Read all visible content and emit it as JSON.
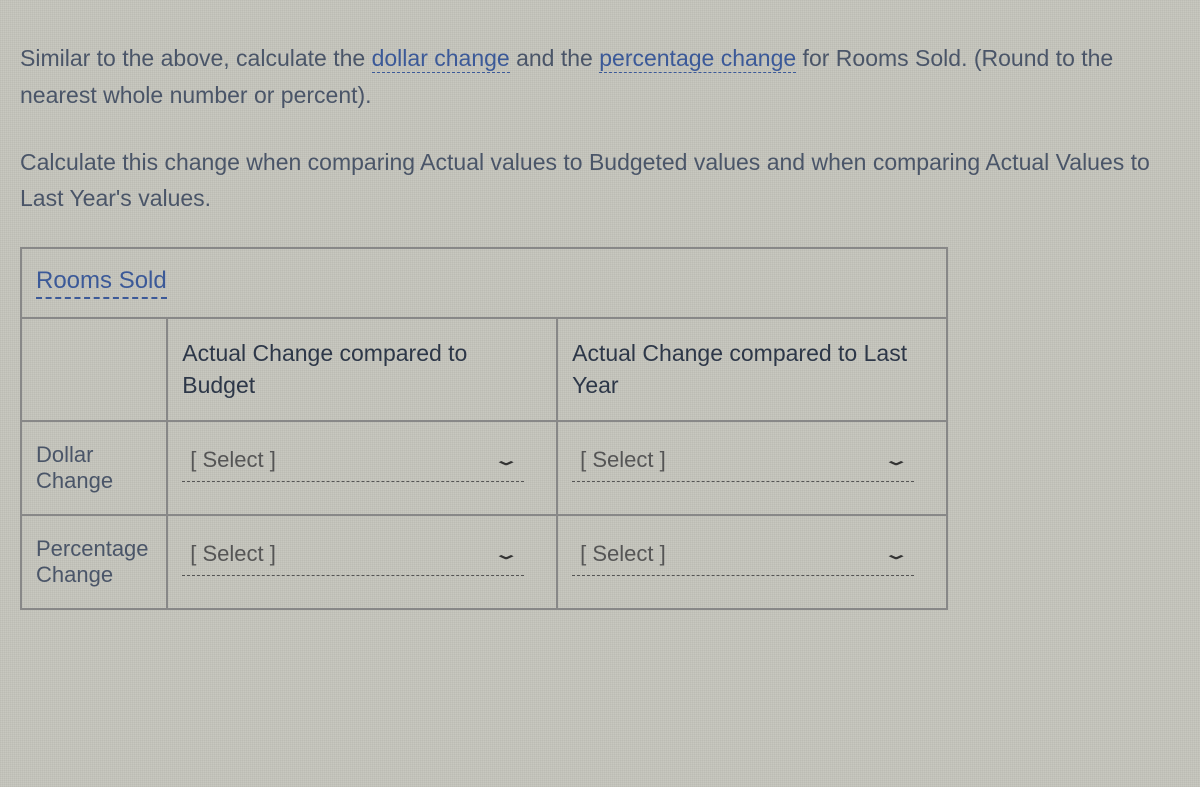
{
  "instructions": {
    "line1_part1": "Similar to the above, calculate the ",
    "line1_link1": "dollar change",
    "line1_part2": " and the ",
    "line1_link2": "percentage change",
    "line1_part3": " for Rooms Sold. (Round to the nearest whole number or percent).",
    "line2_part1": "Calculate this change when comparing Actual values to Budgeted values and when comparing Actual Values to Last Year's values."
  },
  "table": {
    "title": "Rooms Sold",
    "headers": {
      "col1": "Actual Change compared to Budget",
      "col2": "Actual Change compared to Last Year"
    },
    "rows": {
      "dollar": {
        "label": "Dollar Change",
        "select1": "[ Select ]",
        "select2": "[ Select ]"
      },
      "percentage": {
        "label": "Percentage Change",
        "select1": "[ Select ]",
        "select2": "[ Select ]"
      }
    }
  }
}
